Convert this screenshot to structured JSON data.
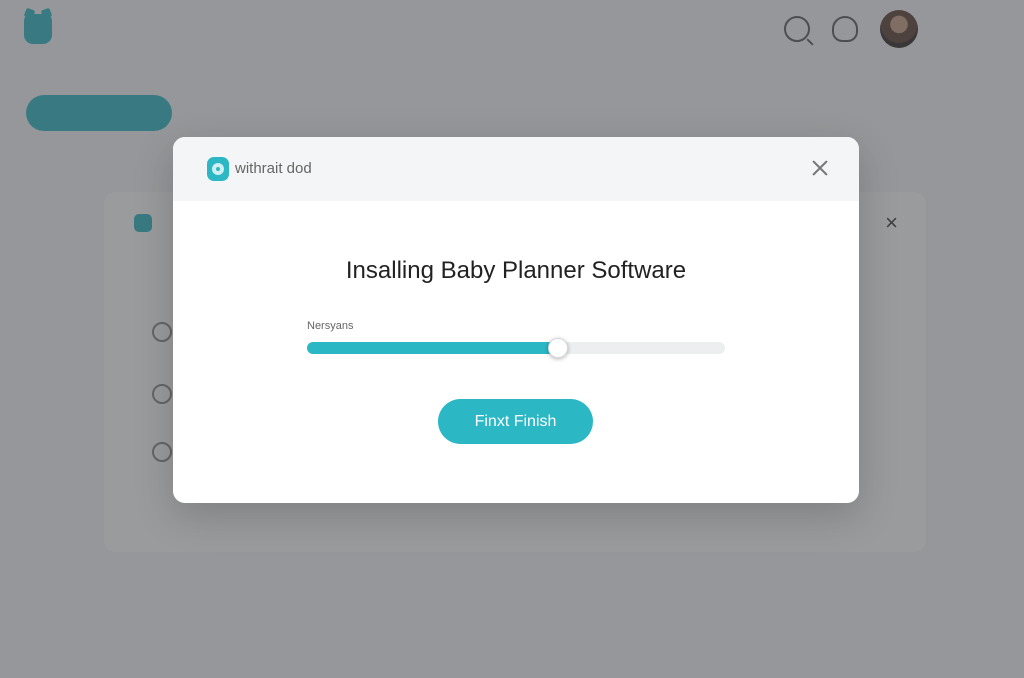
{
  "colors": {
    "accent": "#2bb7c4",
    "overlay": "rgba(70,72,76,0.55)"
  },
  "background_app": {
    "logo_text": "",
    "title": "",
    "sidebar_button": "",
    "sidebar_items": [
      "",
      "",
      ""
    ],
    "breadcrumb": "",
    "user_name": "",
    "back_dialog": {
      "label": "",
      "text": "",
      "rows": [
        "",
        "",
        ""
      ]
    }
  },
  "modal": {
    "brand": "withrait dod",
    "title": "Insalling Baby Planner Software",
    "progress_label": "Nersyans",
    "progress": 0.6,
    "button_label": "Finxt Finish"
  }
}
